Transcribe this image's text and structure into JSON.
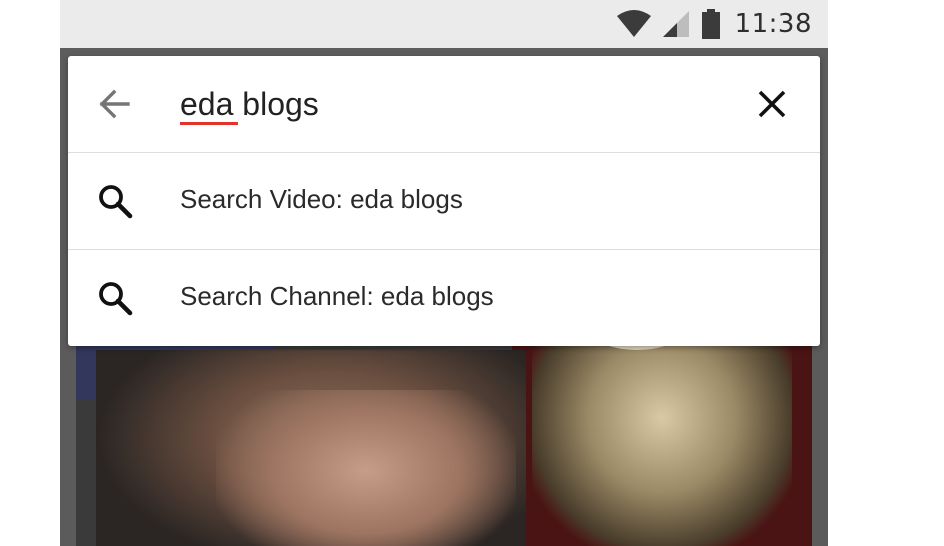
{
  "status_bar": {
    "time": "11:38",
    "icons": [
      "wifi-icon",
      "cellular-signal-icon",
      "battery-icon"
    ]
  },
  "search": {
    "query": "eda blogs",
    "back_icon": "arrow-back-icon",
    "clear_icon": "close-icon",
    "spellcheck_underline_color": "#e2342a"
  },
  "suggestions": [
    {
      "icon": "search-icon",
      "label": "Search Video: eda blogs"
    },
    {
      "icon": "search-icon",
      "label": "Search Channel: eda blogs"
    }
  ],
  "colors": {
    "status_bar_bg": "#ebebeb",
    "overlay_bg": "#5b5b5b",
    "card_bg": "#ffffff",
    "text": "#222222"
  }
}
